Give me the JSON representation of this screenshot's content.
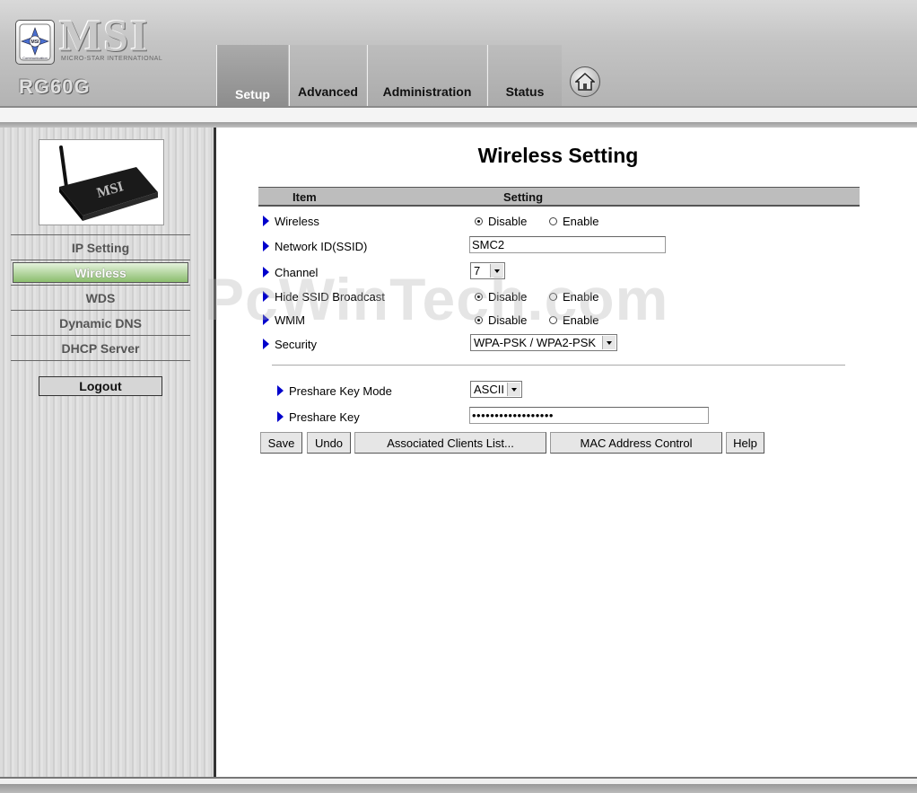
{
  "brand": {
    "logo": "MSI",
    "logo_sub": "MICRO-STAR INTERNATIONAL",
    "badge": "MSI",
    "badge_sub": "Communication",
    "model": "RG60G"
  },
  "nav_tabs": [
    {
      "label": "Setup",
      "active": true
    },
    {
      "label": "Advanced",
      "active": false
    },
    {
      "label": "Administration",
      "active": false
    },
    {
      "label": "Status",
      "active": false
    }
  ],
  "sidebar": {
    "device_label": "MSI",
    "items": [
      {
        "label": "IP Setting",
        "active": false
      },
      {
        "label": "Wireless",
        "active": true
      },
      {
        "label": "WDS",
        "active": false
      },
      {
        "label": "Dynamic DNS",
        "active": false
      },
      {
        "label": "DHCP Server",
        "active": false
      }
    ],
    "logout": "Logout"
  },
  "main": {
    "title": "Wireless Setting",
    "col_item": "Item",
    "col_setting": "Setting",
    "rows": {
      "wireless": {
        "label": "Wireless",
        "opt1": "Disable",
        "opt2": "Enable",
        "selected": "Disable"
      },
      "ssid": {
        "label": "Network ID(SSID)",
        "value": "SMC2"
      },
      "channel": {
        "label": "Channel",
        "value": "7"
      },
      "hide_ssid": {
        "label": "Hide SSID Broadcast",
        "opt1": "Disable",
        "opt2": "Enable",
        "selected": "Disable"
      },
      "wmm": {
        "label": "WMM",
        "opt1": "Disable",
        "opt2": "Enable",
        "selected": "Disable"
      },
      "security": {
        "label": "Security",
        "value": "WPA-PSK / WPA2-PSK"
      },
      "psk_mode": {
        "label": "Preshare Key Mode",
        "value": "ASCII"
      },
      "psk": {
        "label": "Preshare Key",
        "value": "••••••••••••••••••"
      }
    },
    "buttons": {
      "save": "Save",
      "undo": "Undo",
      "clients": "Associated Clients List...",
      "mac": "MAC Address Control",
      "help": "Help"
    }
  },
  "watermark": "PcWinTech.com",
  "colors": {
    "accent_arrow": "#0000cc",
    "active_nav": "#8bbd6d"
  }
}
